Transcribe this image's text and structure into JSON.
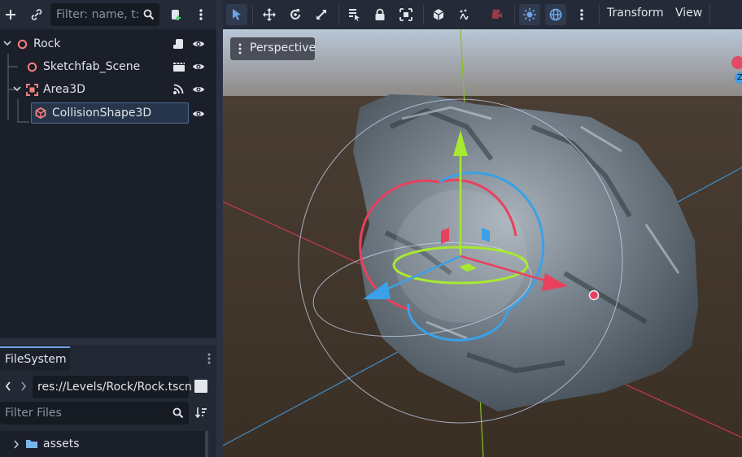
{
  "scene_panel": {
    "filter_placeholder": "Filter: name, t:t",
    "nodes": [
      {
        "label": "Rock",
        "type": "Node3D"
      },
      {
        "label": "Sketchfab_Scene",
        "type": "Node3D"
      },
      {
        "label": "Area3D",
        "type": "Area3D"
      },
      {
        "label": "CollisionShape3D",
        "type": "CollisionShape3D",
        "selected": true
      }
    ]
  },
  "filesystem": {
    "tab_label": "FileSystem",
    "path": "res://Levels/Rock/Rock.tscn",
    "filter_placeholder": "Filter Files",
    "items": [
      {
        "label": "assets",
        "type": "folder"
      }
    ]
  },
  "viewport_toolbar": {
    "menus": [
      "Transform",
      "View"
    ]
  },
  "viewport": {
    "camera_label": "Perspective",
    "gizmo_badge": "Z"
  },
  "colors": {
    "x_axis": "#e8415e",
    "y_axis": "#a7e830",
    "z_axis": "#3aa1e8",
    "accent": "#6ea3e6",
    "node3d_icon": "#fc7f7f"
  }
}
